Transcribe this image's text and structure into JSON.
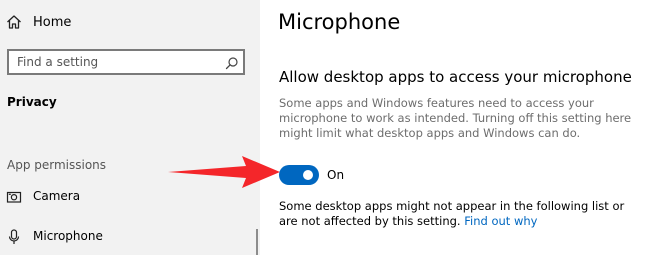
{
  "sidebar": {
    "home_label": "Home",
    "search_placeholder": "Find a setting",
    "category_title": "Privacy",
    "group_title": "App permissions",
    "items": [
      {
        "label": "Camera",
        "icon": "camera-icon"
      },
      {
        "label": "Microphone",
        "icon": "microphone-icon"
      }
    ]
  },
  "main": {
    "page_title": "Microphone",
    "section_title": "Allow desktop apps to access your microphone",
    "description": "Some apps and Windows features need to access your microphone to work as intended. Turning off this setting here might limit what desktop apps and Windows can do.",
    "toggle": {
      "state": "On",
      "is_on": true
    },
    "note_text": "Some desktop apps might not appear in the following list or are not affected by this setting.",
    "note_link": "Find out why"
  },
  "annotation": {
    "arrow_color": "#f4262a",
    "arrow_icon": "arrow-right-icon"
  },
  "colors": {
    "accent": "#0067c0",
    "sidebar_background": "#f2f2f2",
    "description_text": "#6d6d6d"
  }
}
